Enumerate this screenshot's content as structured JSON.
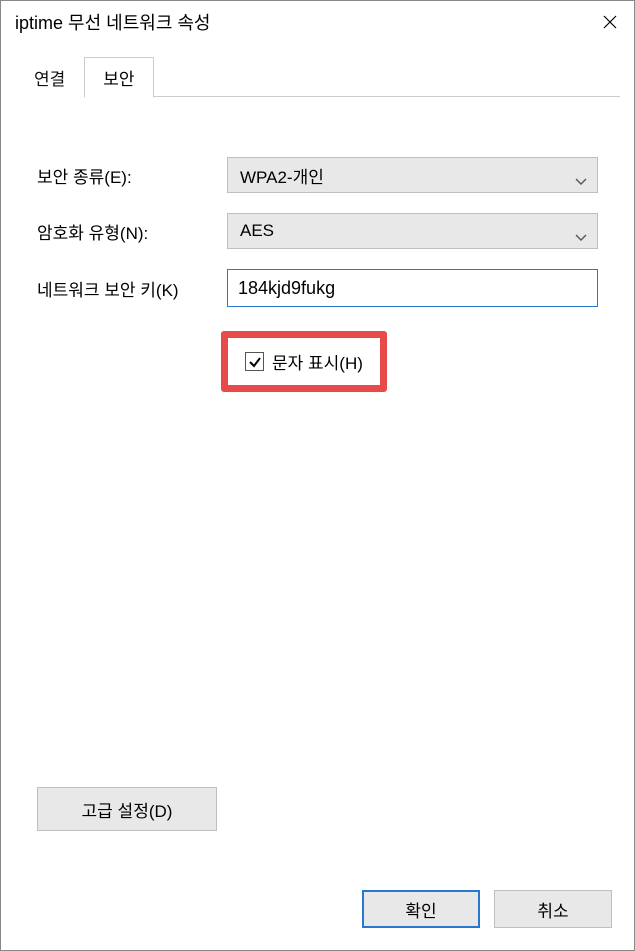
{
  "window": {
    "title": "iptime 무선 네트워크 속성"
  },
  "tabs": {
    "connection": "연결",
    "security": "보안"
  },
  "form": {
    "security_type_label": "보안 종류(E):",
    "security_type_value": "WPA2-개인",
    "encryption_label": "암호화 유형(N):",
    "encryption_value": "AES",
    "key_label": "네트워크 보안 키(K)",
    "key_value": "184kjd9fukg",
    "show_chars_label": "문자 표시(H)",
    "show_chars_checked": true
  },
  "buttons": {
    "advanced": "고급 설정(D)",
    "ok": "확인",
    "cancel": "취소"
  }
}
